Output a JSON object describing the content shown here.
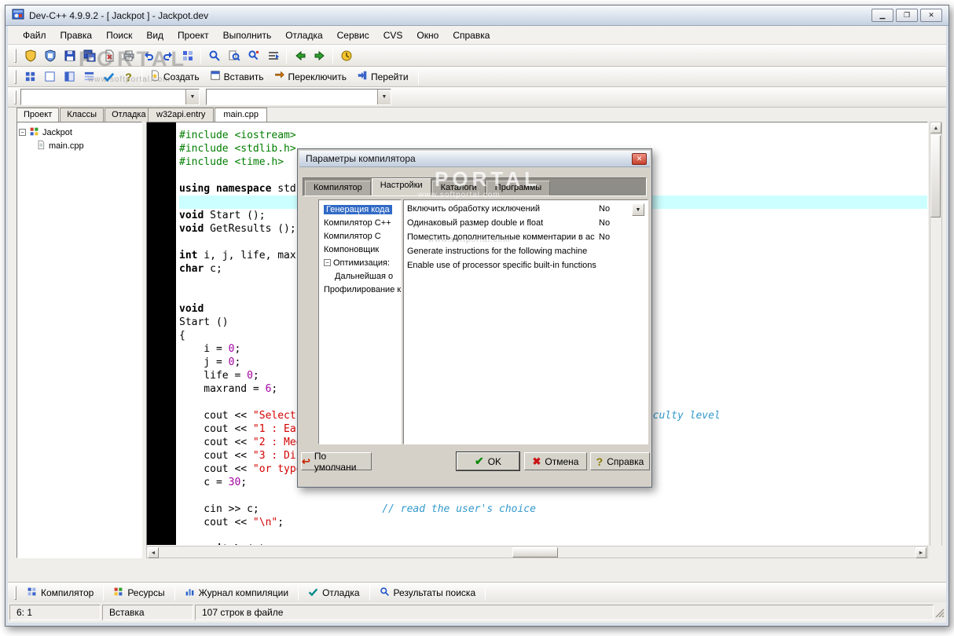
{
  "window": {
    "title": "Dev-C++ 4.9.9.2  -  [ Jackpot ] - Jackpot.dev"
  },
  "watermarks": {
    "brand": "PORTAL",
    "site": "www.softportal.com"
  },
  "menu": {
    "items": [
      "Файл",
      "Правка",
      "Поиск",
      "Вид",
      "Проект",
      "Выполнить",
      "Отладка",
      "Сервис",
      "CVS",
      "Окно",
      "Справка"
    ]
  },
  "toolbar2": {
    "create": "Создать",
    "insert": "Вставить",
    "switch": "Переключить",
    "goto": "Перейти"
  },
  "combos": {
    "combo1": "",
    "combo2": ""
  },
  "sidebar": {
    "tabs": [
      "Проект",
      "Классы",
      "Отладка"
    ],
    "active_tab": "Проект",
    "tree": {
      "root": "Jackpot",
      "child": "main.cpp"
    }
  },
  "editor": {
    "tabs": [
      "w32api.entry",
      "main.cpp"
    ],
    "active_tab": "main.cpp",
    "highlight_line": 5,
    "code_lines": [
      [
        {
          "t": "#include <iostream>",
          "c": "pp"
        }
      ],
      [
        {
          "t": "#include <stdlib.h>",
          "c": "pp"
        }
      ],
      [
        {
          "t": "#include <time.h>",
          "c": "pp"
        }
      ],
      [],
      [
        {
          "t": "using",
          "c": "kw"
        },
        {
          "t": " "
        },
        {
          "t": "namespace",
          "c": "kw"
        },
        {
          "t": " std;"
        }
      ],
      [],
      [
        {
          "t": "void",
          "c": "kw"
        },
        {
          "t": " Start ();"
        }
      ],
      [
        {
          "t": "void",
          "c": "kw"
        },
        {
          "t": " GetResults ();"
        }
      ],
      [],
      [
        {
          "t": "int",
          "c": "kw"
        },
        {
          "t": " i, j, life, maxrand;"
        }
      ],
      [
        {
          "t": "char",
          "c": "kw"
        },
        {
          "t": " c;"
        }
      ],
      [],
      [],
      [
        {
          "t": "void",
          "c": "kw"
        }
      ],
      [
        {
          "t": "Start ()"
        }
      ],
      [
        {
          "t": "{"
        }
      ],
      [
        {
          "t": "    i = "
        },
        {
          "t": "0",
          "c": "num"
        },
        {
          "t": ";"
        }
      ],
      [
        {
          "t": "    j = "
        },
        {
          "t": "0",
          "c": "num"
        },
        {
          "t": ";"
        }
      ],
      [
        {
          "t": "    life = "
        },
        {
          "t": "0",
          "c": "num"
        },
        {
          "t": ";"
        }
      ],
      [
        {
          "t": "    maxrand = "
        },
        {
          "t": "6",
          "c": "num"
        },
        {
          "t": ";"
        }
      ],
      [],
      [
        {
          "t": "    cout << "
        },
        {
          "t": "\"Select a difficulty level :\\n\\n\"",
          "c": "str"
        },
        {
          "t": ";            "
        },
        {
          "t": "// select the difficulty level",
          "c": "com"
        }
      ],
      [
        {
          "t": "    cout << "
        },
        {
          "t": "\"1 : Easy\\n\"",
          "c": "str"
        },
        {
          "t": ";"
        }
      ],
      [
        {
          "t": "    cout << "
        },
        {
          "t": "\"2 : Medium\\n\"",
          "c": "str"
        },
        {
          "t": ";"
        }
      ],
      [
        {
          "t": "    cout << "
        },
        {
          "t": "\"3 : Difficult\\n\"",
          "c": "str"
        },
        {
          "t": ";"
        }
      ],
      [
        {
          "t": "    cout << "
        },
        {
          "t": "\"or type anything else to quit.\\n\\n\"",
          "c": "str"
        },
        {
          "t": ";"
        }
      ],
      [
        {
          "t": "    c = "
        },
        {
          "t": "30",
          "c": "num"
        },
        {
          "t": ";"
        }
      ],
      [],
      [
        {
          "t": "    cin >> c;                    "
        },
        {
          "t": "// read the user's choice",
          "c": "com"
        }
      ],
      [
        {
          "t": "    cout << "
        },
        {
          "t": "\"\\n\"",
          "c": "str"
        },
        {
          "t": ";"
        }
      ],
      [],
      [
        {
          "t": "    "
        },
        {
          "t": "switch",
          "c": "kw"
        },
        {
          "t": " (c)"
        }
      ]
    ]
  },
  "dialog": {
    "title": "Параметры компилятора",
    "tabs": [
      "Компилятор",
      "Настройки",
      "Каталоги",
      "Программы"
    ],
    "active_tab": "Настройки",
    "tree": [
      "Генерация кода",
      "Компилятор C++",
      "Компилятор C",
      "Компоновщик",
      "Оптимизация:",
      "Дальнейшая о",
      "Профилирование к"
    ],
    "settings": [
      {
        "label": "Включить обработку исключений",
        "value": "No"
      },
      {
        "label": "Одинаковый размер double и float",
        "value": "No"
      },
      {
        "label": "Поместить дополнительные комментарии в ас",
        "value": "No"
      },
      {
        "label": "Generate instructions for the following machine",
        "value": ""
      },
      {
        "label": "Enable use of processor specific built-in functions",
        "value": ""
      }
    ],
    "buttons": {
      "default": "По умолчани",
      "ok": "OK",
      "cancel": "Отмена",
      "help": "Справка"
    }
  },
  "bottom_bar": {
    "tabs": [
      "Компилятор",
      "Ресурсы",
      "Журнал компиляции",
      "Отладка",
      "Результаты поиска"
    ]
  },
  "status_bar": {
    "cursor": "6: 1",
    "mode": "Вставка",
    "info": "107 строк в файле"
  }
}
